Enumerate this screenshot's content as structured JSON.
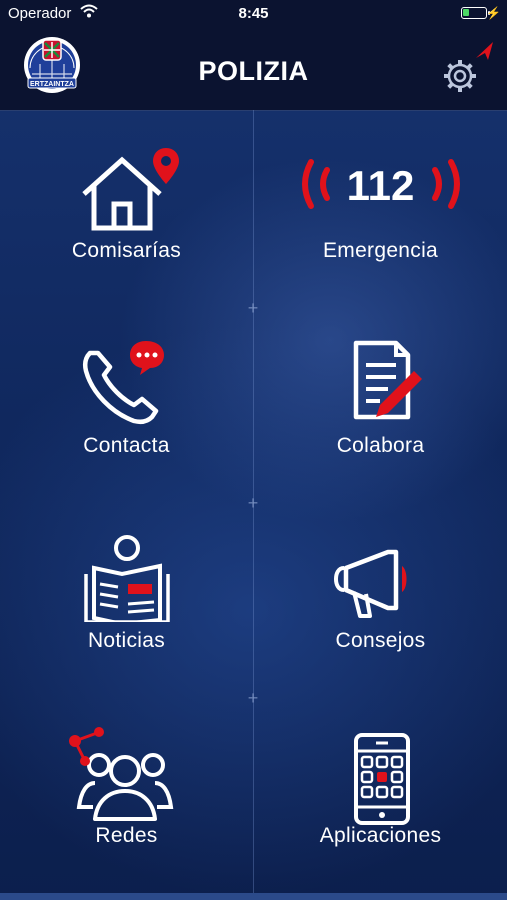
{
  "status": {
    "carrier": "Operador",
    "time": "8:45"
  },
  "header": {
    "title": "POLIZIA",
    "logo_text": "ERTZAINTZA"
  },
  "menu": [
    {
      "label": "Comisarías",
      "icon": "house-location-icon"
    },
    {
      "label": "Emergencia",
      "icon": "emergency-112-icon",
      "number": "112"
    },
    {
      "label": "Contacta",
      "icon": "phone-chat-icon"
    },
    {
      "label": "Colabora",
      "icon": "document-pencil-icon"
    },
    {
      "label": "Noticias",
      "icon": "newspaper-reader-icon"
    },
    {
      "label": "Consejos",
      "icon": "megaphone-icon"
    },
    {
      "label": "Redes",
      "icon": "social-network-icon"
    },
    {
      "label": "Aplicaciones",
      "icon": "phone-apps-icon"
    }
  ],
  "colors": {
    "accent": "#e0121b",
    "header_bg": "#0b1330",
    "background": "#10285e",
    "icon": "#ffffff"
  }
}
